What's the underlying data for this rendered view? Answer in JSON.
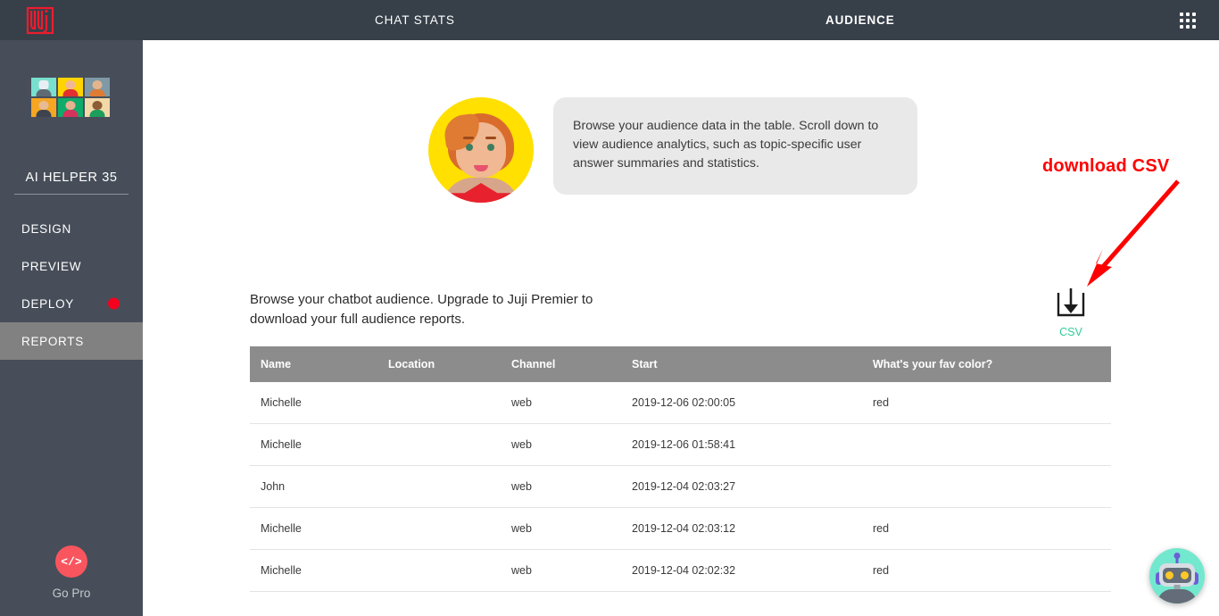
{
  "topbar": {
    "logo_name": "Juji",
    "tabs": [
      {
        "label": "CHAT STATS",
        "active": false
      },
      {
        "label": "AUDIENCE",
        "active": true
      }
    ],
    "apps_icon": "grid-apps-icon"
  },
  "sidebar": {
    "bot_name": "AI HELPER 35",
    "avatars": [
      {
        "name": "robot-avatar",
        "bg": "#79e0cf",
        "head": "#ffffff",
        "body": "#5f6a75"
      },
      {
        "name": "blonde-avatar",
        "bg": "#ffd400",
        "head": "#f0b893",
        "body": "#e03030"
      },
      {
        "name": "gray-avatar",
        "bg": "#7f9aa6",
        "head": "#e3b58f",
        "body": "#e07b33"
      },
      {
        "name": "orange-avatar",
        "bg": "#f5a623",
        "head": "#e9bb93",
        "body": "#3d4450"
      },
      {
        "name": "green-avatar",
        "bg": "#0fab6a",
        "head": "#e8b190",
        "body": "#d6335c"
      },
      {
        "name": "tan-avatar",
        "bg": "#f3d9a8",
        "head": "#8d5b34",
        "body": "#1c9e5c"
      }
    ],
    "items": [
      {
        "label": "DESIGN",
        "active": false,
        "badge": false
      },
      {
        "label": "PREVIEW",
        "active": false,
        "badge": false
      },
      {
        "label": "DEPLOY",
        "active": false,
        "badge": true
      },
      {
        "label": "REPORTS",
        "active": true,
        "badge": false
      }
    ],
    "gopro": {
      "icon_text": "</>",
      "label": "Go Pro",
      "color": "#f9555f"
    },
    "badge_color": "#f5001e"
  },
  "main": {
    "greeting_message": "Browse your audience data in the table. Scroll down to view audience analytics, such as topic-specific user answer summaries and statistics.",
    "hero_avatar_name": "female-assistant-avatar",
    "annotation": {
      "text": "download CSV",
      "color": "#ff0000"
    },
    "csv": {
      "label": "CSV",
      "icon_name": "download-icon",
      "label_color": "#2fcf9a"
    },
    "description": "Browse your chatbot audience. Upgrade to Juji Premier to download your full audience reports.",
    "table": {
      "columns": [
        "Name",
        "Location",
        "Channel",
        "Start",
        "What's your fav color?"
      ],
      "rows": [
        {
          "name": "Michelle",
          "location": "",
          "channel": "web",
          "start": "2019-12-06 02:00:05",
          "answer": "red"
        },
        {
          "name": "Michelle",
          "location": "",
          "channel": "web",
          "start": "2019-12-06 01:58:41",
          "answer": ""
        },
        {
          "name": "John",
          "location": "",
          "channel": "web",
          "start": "2019-12-04 02:03:27",
          "answer": ""
        },
        {
          "name": "Michelle",
          "location": "",
          "channel": "web",
          "start": "2019-12-04 02:03:12",
          "answer": "red"
        },
        {
          "name": "Michelle",
          "location": "",
          "channel": "web",
          "start": "2019-12-04 02:02:32",
          "answer": "red"
        }
      ],
      "header_bg": "#8c8c8c"
    }
  },
  "chat_widget": {
    "name": "chatbot-launcher",
    "bg": "#72e8cf"
  }
}
